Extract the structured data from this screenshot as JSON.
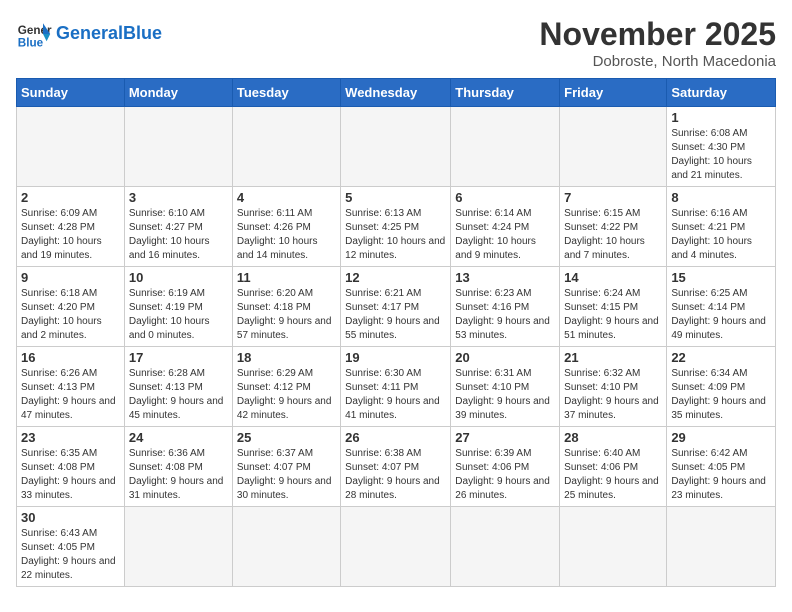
{
  "header": {
    "logo_general": "General",
    "logo_blue": "Blue",
    "month_year": "November 2025",
    "location": "Dobroste, North Macedonia"
  },
  "weekdays": [
    "Sunday",
    "Monday",
    "Tuesday",
    "Wednesday",
    "Thursday",
    "Friday",
    "Saturday"
  ],
  "weeks": [
    [
      {
        "day": "",
        "info": ""
      },
      {
        "day": "",
        "info": ""
      },
      {
        "day": "",
        "info": ""
      },
      {
        "day": "",
        "info": ""
      },
      {
        "day": "",
        "info": ""
      },
      {
        "day": "",
        "info": ""
      },
      {
        "day": "1",
        "info": "Sunrise: 6:08 AM\nSunset: 4:30 PM\nDaylight: 10 hours and 21 minutes."
      }
    ],
    [
      {
        "day": "2",
        "info": "Sunrise: 6:09 AM\nSunset: 4:28 PM\nDaylight: 10 hours and 19 minutes."
      },
      {
        "day": "3",
        "info": "Sunrise: 6:10 AM\nSunset: 4:27 PM\nDaylight: 10 hours and 16 minutes."
      },
      {
        "day": "4",
        "info": "Sunrise: 6:11 AM\nSunset: 4:26 PM\nDaylight: 10 hours and 14 minutes."
      },
      {
        "day": "5",
        "info": "Sunrise: 6:13 AM\nSunset: 4:25 PM\nDaylight: 10 hours and 12 minutes."
      },
      {
        "day": "6",
        "info": "Sunrise: 6:14 AM\nSunset: 4:24 PM\nDaylight: 10 hours and 9 minutes."
      },
      {
        "day": "7",
        "info": "Sunrise: 6:15 AM\nSunset: 4:22 PM\nDaylight: 10 hours and 7 minutes."
      },
      {
        "day": "8",
        "info": "Sunrise: 6:16 AM\nSunset: 4:21 PM\nDaylight: 10 hours and 4 minutes."
      }
    ],
    [
      {
        "day": "9",
        "info": "Sunrise: 6:18 AM\nSunset: 4:20 PM\nDaylight: 10 hours and 2 minutes."
      },
      {
        "day": "10",
        "info": "Sunrise: 6:19 AM\nSunset: 4:19 PM\nDaylight: 10 hours and 0 minutes."
      },
      {
        "day": "11",
        "info": "Sunrise: 6:20 AM\nSunset: 4:18 PM\nDaylight: 9 hours and 57 minutes."
      },
      {
        "day": "12",
        "info": "Sunrise: 6:21 AM\nSunset: 4:17 PM\nDaylight: 9 hours and 55 minutes."
      },
      {
        "day": "13",
        "info": "Sunrise: 6:23 AM\nSunset: 4:16 PM\nDaylight: 9 hours and 53 minutes."
      },
      {
        "day": "14",
        "info": "Sunrise: 6:24 AM\nSunset: 4:15 PM\nDaylight: 9 hours and 51 minutes."
      },
      {
        "day": "15",
        "info": "Sunrise: 6:25 AM\nSunset: 4:14 PM\nDaylight: 9 hours and 49 minutes."
      }
    ],
    [
      {
        "day": "16",
        "info": "Sunrise: 6:26 AM\nSunset: 4:13 PM\nDaylight: 9 hours and 47 minutes."
      },
      {
        "day": "17",
        "info": "Sunrise: 6:28 AM\nSunset: 4:13 PM\nDaylight: 9 hours and 45 minutes."
      },
      {
        "day": "18",
        "info": "Sunrise: 6:29 AM\nSunset: 4:12 PM\nDaylight: 9 hours and 42 minutes."
      },
      {
        "day": "19",
        "info": "Sunrise: 6:30 AM\nSunset: 4:11 PM\nDaylight: 9 hours and 41 minutes."
      },
      {
        "day": "20",
        "info": "Sunrise: 6:31 AM\nSunset: 4:10 PM\nDaylight: 9 hours and 39 minutes."
      },
      {
        "day": "21",
        "info": "Sunrise: 6:32 AM\nSunset: 4:10 PM\nDaylight: 9 hours and 37 minutes."
      },
      {
        "day": "22",
        "info": "Sunrise: 6:34 AM\nSunset: 4:09 PM\nDaylight: 9 hours and 35 minutes."
      }
    ],
    [
      {
        "day": "23",
        "info": "Sunrise: 6:35 AM\nSunset: 4:08 PM\nDaylight: 9 hours and 33 minutes."
      },
      {
        "day": "24",
        "info": "Sunrise: 6:36 AM\nSunset: 4:08 PM\nDaylight: 9 hours and 31 minutes."
      },
      {
        "day": "25",
        "info": "Sunrise: 6:37 AM\nSunset: 4:07 PM\nDaylight: 9 hours and 30 minutes."
      },
      {
        "day": "26",
        "info": "Sunrise: 6:38 AM\nSunset: 4:07 PM\nDaylight: 9 hours and 28 minutes."
      },
      {
        "day": "27",
        "info": "Sunrise: 6:39 AM\nSunset: 4:06 PM\nDaylight: 9 hours and 26 minutes."
      },
      {
        "day": "28",
        "info": "Sunrise: 6:40 AM\nSunset: 4:06 PM\nDaylight: 9 hours and 25 minutes."
      },
      {
        "day": "29",
        "info": "Sunrise: 6:42 AM\nSunset: 4:05 PM\nDaylight: 9 hours and 23 minutes."
      }
    ],
    [
      {
        "day": "30",
        "info": "Sunrise: 6:43 AM\nSunset: 4:05 PM\nDaylight: 9 hours and 22 minutes."
      },
      {
        "day": "",
        "info": ""
      },
      {
        "day": "",
        "info": ""
      },
      {
        "day": "",
        "info": ""
      },
      {
        "day": "",
        "info": ""
      },
      {
        "day": "",
        "info": ""
      },
      {
        "day": "",
        "info": ""
      }
    ]
  ]
}
